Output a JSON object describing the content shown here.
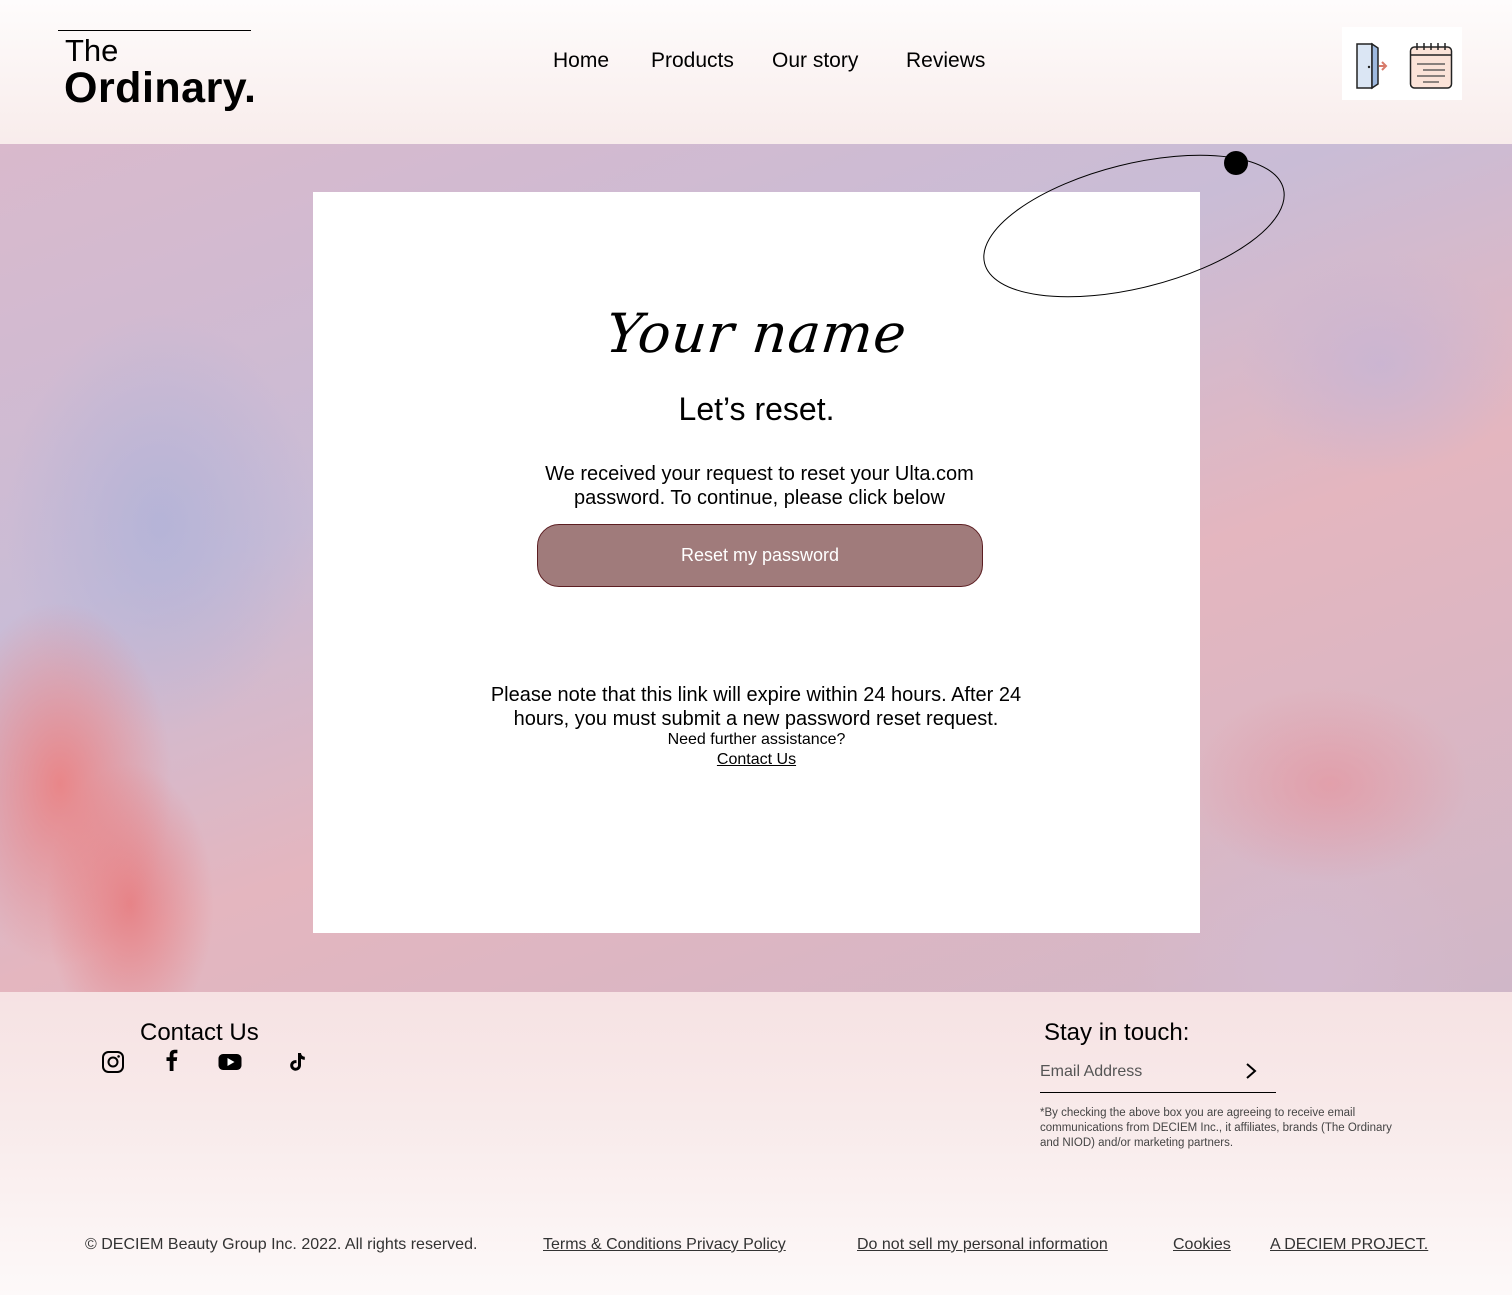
{
  "header": {
    "logo_the": "The",
    "logo_ordinary": "Ordinary.",
    "nav": [
      "Home",
      "Products",
      "Our story",
      "Reviews"
    ],
    "icons": [
      "door-exit-icon",
      "notepad-icon"
    ]
  },
  "card": {
    "script_name": "Your name",
    "title": "Let’s reset.",
    "description": "We received your request to reset your Ulta.com password. To continue, please click below",
    "button_label": "Reset my password",
    "note": "Please note that this link will expire within 24 hours. After 24 hours, you must submit a new password reset request.",
    "assist": "Need further assistance?",
    "contact_link": "Contact Us",
    "button_color": "#a07b7b"
  },
  "footer": {
    "contact_title": "Contact Us",
    "social": [
      "instagram-icon",
      "facebook-icon",
      "youtube-icon",
      "tiktok-icon"
    ],
    "stay_title": "Stay in touch:",
    "email_placeholder": "Email Address",
    "disclaimer": "*By checking the above box you are agreeing to receive email communications from DECIEM Inc., it affiliates, brands (The Ordinary and NIOD) and/or marketing partners.",
    "copyright": "© DECIEM Beauty Group Inc. 2022. All rights reserved.",
    "links": [
      "Terms & Conditions Privacy Policy",
      "Do not sell my personal information",
      "Cookies",
      "A DECIEM PROJECT."
    ]
  }
}
